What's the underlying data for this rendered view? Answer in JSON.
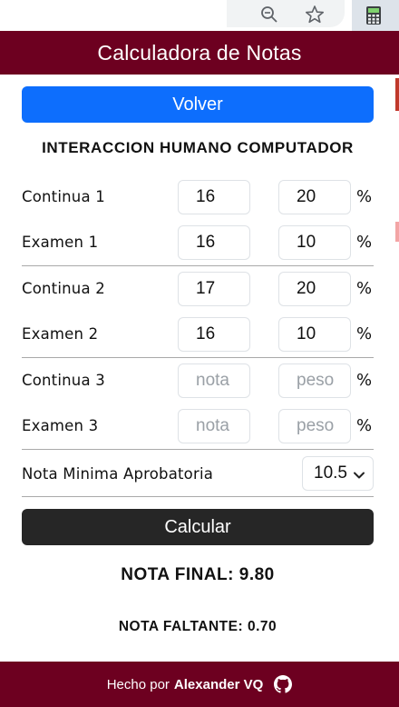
{
  "browser": {
    "icons": [
      "zoom-out-icon",
      "star-icon",
      "calculator-extension-icon"
    ]
  },
  "header": {
    "title": "Calculadora de Notas"
  },
  "volver_label": "Volver",
  "course_title": "INTERACCION HUMANO COMPUTADOR",
  "rows": [
    {
      "label": "Continua 1",
      "nota": "16",
      "peso": "20"
    },
    {
      "label": "Examen 1",
      "nota": "16",
      "peso": "10"
    },
    {
      "label": "Continua 2",
      "nota": "17",
      "peso": "20"
    },
    {
      "label": "Examen 2",
      "nota": "16",
      "peso": "10"
    },
    {
      "label": "Continua 3",
      "nota": "",
      "peso": ""
    },
    {
      "label": "Examen 3",
      "nota": "",
      "peso": ""
    }
  ],
  "placeholders": {
    "nota": "nota",
    "peso": "peso"
  },
  "percent_symbol": "%",
  "minimum": {
    "label": "Nota Minima Aprobatoria",
    "selected": "10.5"
  },
  "calcular_label": "Calcular",
  "nota_final": "NOTA FINAL: 9.80",
  "nota_faltante": "NOTA FALTANTE: 0.70",
  "footer": {
    "prefix": "Hecho por",
    "author": "Alexander VQ",
    "icon": "github-icon"
  },
  "colors": {
    "brand": "#6d0020",
    "primary": "#0d6efd",
    "dark": "#262626"
  }
}
